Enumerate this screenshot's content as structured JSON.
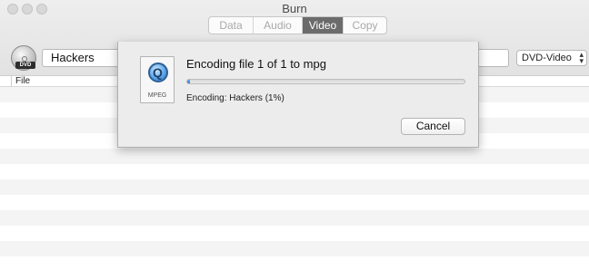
{
  "window": {
    "title": "Burn"
  },
  "tabs": [
    {
      "label": "Data",
      "active": false
    },
    {
      "label": "Audio",
      "active": false
    },
    {
      "label": "Video",
      "active": true
    },
    {
      "label": "Copy",
      "active": false
    }
  ],
  "toolbar": {
    "disc_label": "DVD",
    "disc_name": "Hackers",
    "format_selected": "DVD-Video"
  },
  "file_list": {
    "columns": [
      "File"
    ],
    "rows": []
  },
  "dialog": {
    "icon_label": "MPEG",
    "title": "Encoding file 1 of 1 to mpg",
    "progress": 0.01,
    "status": "Encoding: Hackers (1%)",
    "cancel_label": "Cancel"
  },
  "colors": {
    "active_tab": "#6b6b6b",
    "progress_fill": "#2f7dd6"
  }
}
